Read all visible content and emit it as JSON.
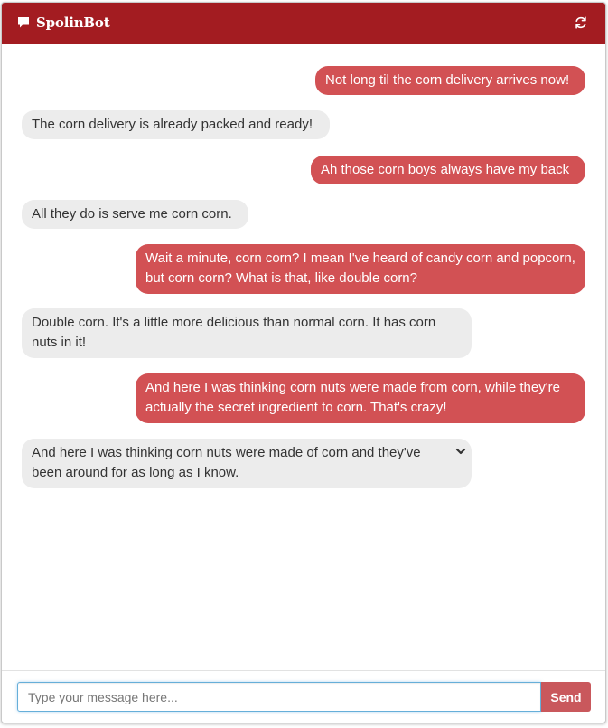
{
  "header": {
    "title": "SpolinBot",
    "chat_icon": "speech-bubble-icon",
    "refresh_icon": "refresh-icon"
  },
  "colors": {
    "header_bg": "#a31c21",
    "user_bubble": "#d25154",
    "bot_bubble": "#ececec",
    "send_button": "#c9585c"
  },
  "messages": [
    {
      "sender": "user",
      "text": "Not long til the corn delivery arrives now!"
    },
    {
      "sender": "bot",
      "text": "The corn delivery is already packed and ready!"
    },
    {
      "sender": "user",
      "text": "Ah those corn boys always have my back"
    },
    {
      "sender": "bot",
      "text": "All they do is serve me corn corn."
    },
    {
      "sender": "user",
      "text": "Wait a minute, corn corn? I mean I've heard of candy corn and popcorn, but corn corn? What is that, like double corn?"
    },
    {
      "sender": "bot",
      "text": "Double corn. It's a little more delicious than normal corn. It has corn nuts in it!"
    },
    {
      "sender": "user",
      "text": "And here I was thinking corn nuts were made from corn, while they're actually the secret ingredient to corn. That's crazy!"
    },
    {
      "sender": "bot",
      "text": "And here I was thinking corn nuts were made of corn and they've been around for as long as I know.",
      "expand_icon": "chevron-down-icon"
    }
  ],
  "composer": {
    "placeholder": "Type your message here...",
    "value": "",
    "send_label": "Send"
  }
}
